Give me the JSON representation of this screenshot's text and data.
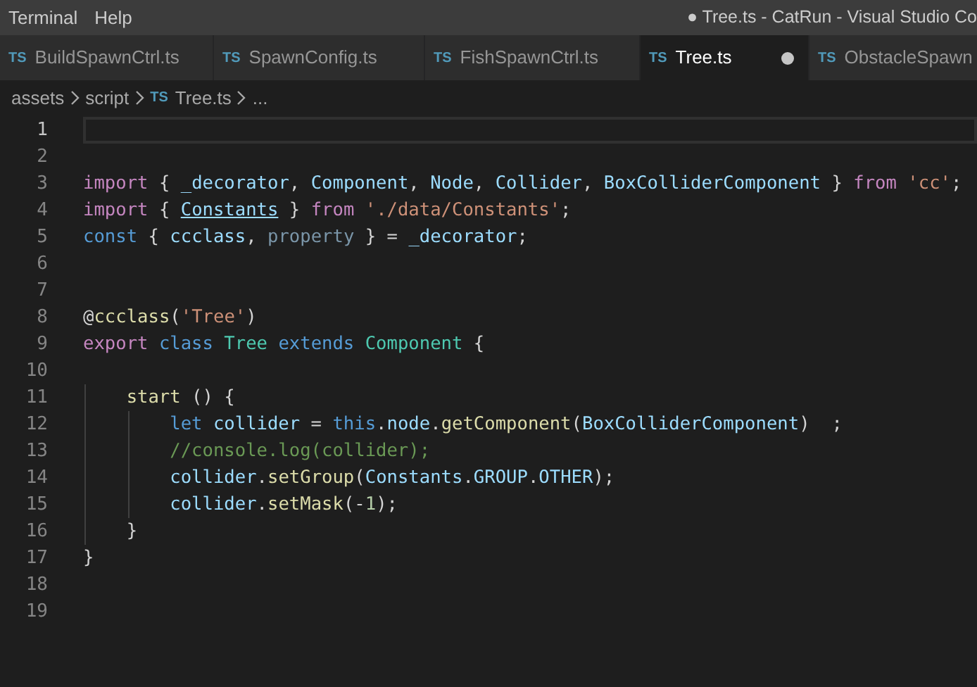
{
  "menu": [
    {
      "label": "Terminal"
    },
    {
      "label": "Help"
    }
  ],
  "window": {
    "title": "● Tree.ts - CatRun - Visual Studio Co"
  },
  "tabs": [
    {
      "icon": "TS",
      "label": "BuildSpawnCtrl.ts",
      "selected": false,
      "modified": false
    },
    {
      "icon": "TS",
      "label": "SpawnConfig.ts",
      "selected": false,
      "modified": false
    },
    {
      "icon": "TS",
      "label": "FishSpawnCtrl.ts",
      "selected": false,
      "modified": false
    },
    {
      "icon": "TS",
      "label": "Tree.ts",
      "selected": true,
      "modified": true
    },
    {
      "icon": "TS",
      "label": "ObstacleSpawn",
      "selected": false,
      "modified": false
    }
  ],
  "breadcrumb": [
    {
      "label": "assets"
    },
    {
      "label": "script"
    },
    {
      "icon": "TS",
      "label": "Tree.ts"
    },
    {
      "label": "..."
    }
  ],
  "lines": [
    {
      "number": "1",
      "current": true
    },
    {
      "number": "2",
      "current": false
    },
    {
      "number": "3",
      "current": false,
      "tokens": [
        {
          "kind": "control",
          "text": "import"
        },
        {
          "kind": "plain",
          "text": " { "
        },
        {
          "kind": "variable",
          "text": "_decorator"
        },
        {
          "kind": "plain",
          "text": ", "
        },
        {
          "kind": "variable",
          "text": "Component"
        },
        {
          "kind": "plain",
          "text": ", "
        },
        {
          "kind": "variable",
          "text": "Node"
        },
        {
          "kind": "plain",
          "text": ", "
        },
        {
          "kind": "variable",
          "text": "Collider"
        },
        {
          "kind": "plain",
          "text": ", "
        },
        {
          "kind": "variable",
          "text": "BoxColliderComponent"
        },
        {
          "kind": "plain",
          "text": " } "
        },
        {
          "kind": "control",
          "text": "from"
        },
        {
          "kind": "string",
          "text": " 'cc'"
        },
        {
          "kind": "plain",
          "text": ";"
        }
      ]
    },
    {
      "number": "4",
      "current": false,
      "tokens": [
        {
          "kind": "control",
          "text": "import"
        },
        {
          "kind": "plain",
          "text": " { "
        },
        {
          "kind": "link",
          "text": "Constants"
        },
        {
          "kind": "plain",
          "text": " } "
        },
        {
          "kind": "control",
          "text": "from"
        },
        {
          "kind": "string",
          "text": " './data/Constants'"
        },
        {
          "kind": "plain",
          "text": ";"
        }
      ]
    },
    {
      "number": "5",
      "current": false,
      "tokens": [
        {
          "kind": "keyword",
          "text": "const"
        },
        {
          "kind": "plain",
          "text": " { "
        },
        {
          "kind": "variable",
          "text": "ccclass"
        },
        {
          "kind": "plain",
          "text": ", "
        },
        {
          "kind": "unused",
          "text": "property"
        },
        {
          "kind": "plain",
          "text": " } = "
        },
        {
          "kind": "variable",
          "text": "_decorator"
        },
        {
          "kind": "plain",
          "text": ";"
        }
      ]
    },
    {
      "number": "6",
      "current": false
    },
    {
      "number": "7",
      "current": false
    },
    {
      "number": "8",
      "current": false,
      "tokens": [
        {
          "kind": "plain",
          "text": "@"
        },
        {
          "kind": "function",
          "text": "ccclass"
        },
        {
          "kind": "plain",
          "text": "("
        },
        {
          "kind": "string",
          "text": "'Tree'"
        },
        {
          "kind": "plain",
          "text": ")"
        }
      ]
    },
    {
      "number": "9",
      "current": false,
      "tokens": [
        {
          "kind": "control",
          "text": "export"
        },
        {
          "kind": "keyword",
          "text": " class"
        },
        {
          "kind": "type",
          "text": " Tree"
        },
        {
          "kind": "keyword",
          "text": " extends"
        },
        {
          "kind": "type",
          "text": " Component"
        },
        {
          "kind": "plain",
          "text": " {"
        }
      ]
    },
    {
      "number": "10",
      "current": false
    },
    {
      "number": "11",
      "current": false,
      "tokens": [
        {
          "kind": "function",
          "text": "    start"
        },
        {
          "kind": "plain",
          "text": " () {"
        }
      ]
    },
    {
      "number": "12",
      "current": false,
      "tokens": [
        {
          "kind": "keyword",
          "text": "        let"
        },
        {
          "kind": "variable",
          "text": " collider"
        },
        {
          "kind": "plain",
          "text": " = "
        },
        {
          "kind": "keyword",
          "text": "this"
        },
        {
          "kind": "plain",
          "text": "."
        },
        {
          "kind": "variable",
          "text": "node"
        },
        {
          "kind": "plain",
          "text": "."
        },
        {
          "kind": "function",
          "text": "getComponent"
        },
        {
          "kind": "plain",
          "text": "("
        },
        {
          "kind": "variable",
          "text": "BoxColliderComponent"
        },
        {
          "kind": "plain",
          "text": ")  ;"
        }
      ]
    },
    {
      "number": "13",
      "current": false,
      "tokens": [
        {
          "kind": "comment",
          "text": "        //console.log(collider);"
        }
      ]
    },
    {
      "number": "14",
      "current": false,
      "tokens": [
        {
          "kind": "variable",
          "text": "        collider"
        },
        {
          "kind": "plain",
          "text": "."
        },
        {
          "kind": "function",
          "text": "setGroup"
        },
        {
          "kind": "plain",
          "text": "("
        },
        {
          "kind": "variable",
          "text": "Constants"
        },
        {
          "kind": "plain",
          "text": "."
        },
        {
          "kind": "variable",
          "text": "GROUP"
        },
        {
          "kind": "plain",
          "text": "."
        },
        {
          "kind": "variable",
          "text": "OTHER"
        },
        {
          "kind": "plain",
          "text": ");"
        }
      ]
    },
    {
      "number": "15",
      "current": false,
      "tokens": [
        {
          "kind": "variable",
          "text": "        collider"
        },
        {
          "kind": "plain",
          "text": "."
        },
        {
          "kind": "function",
          "text": "setMask"
        },
        {
          "kind": "plain",
          "text": "(-"
        },
        {
          "kind": "number",
          "text": "1"
        },
        {
          "kind": "plain",
          "text": ");"
        }
      ]
    },
    {
      "number": "16",
      "current": false,
      "tokens": [
        {
          "kind": "plain",
          "text": "    }"
        }
      ]
    },
    {
      "number": "17",
      "current": false,
      "tokens": [
        {
          "kind": "plain",
          "text": "}"
        }
      ]
    },
    {
      "number": "18",
      "current": false
    },
    {
      "number": "19",
      "current": false
    }
  ]
}
